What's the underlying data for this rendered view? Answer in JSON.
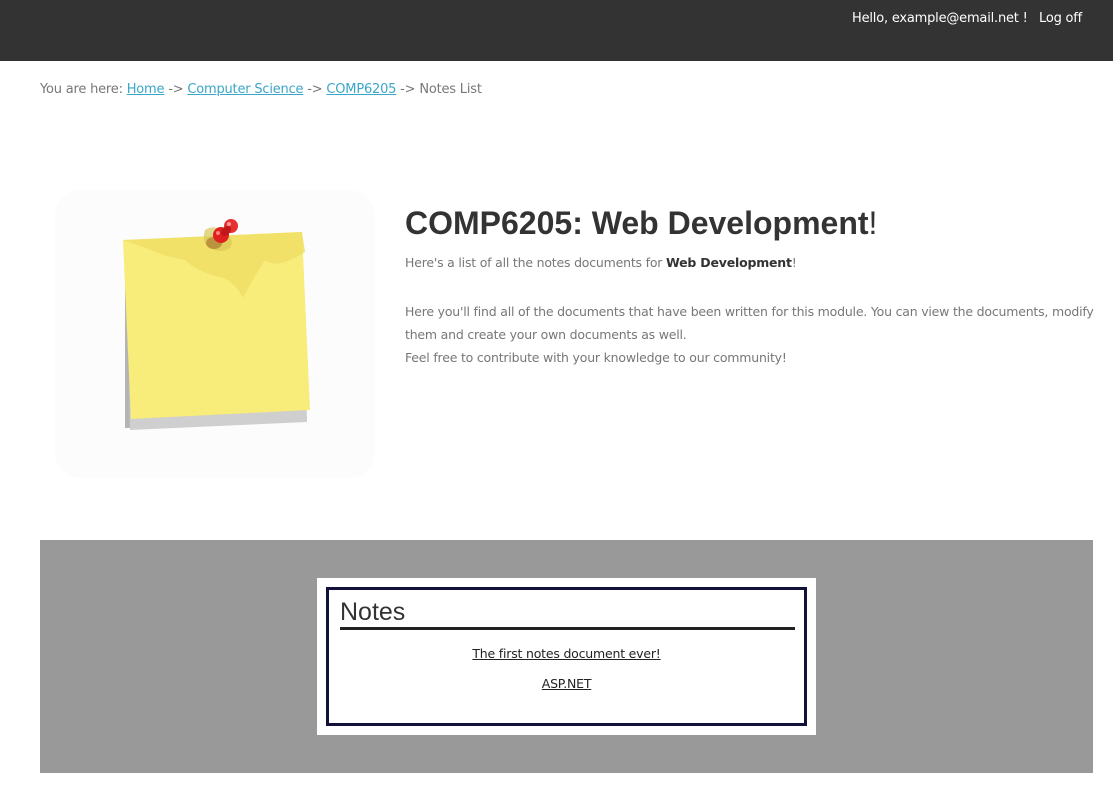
{
  "header": {
    "greeting": "Hello, example@email.net !",
    "logoff_label": "Log off"
  },
  "breadcrumb": {
    "prefix": "You are here:",
    "separator": " -> ",
    "links": [
      "Home",
      "Computer Science",
      "COMP6205"
    ],
    "current": "Notes List"
  },
  "hero": {
    "image": "sticky-note-pin",
    "title": "COMP6205: Web Development",
    "title_suffix": "!",
    "intro_prefix": "Here's a list of all the notes documents for ",
    "intro_bold": "Web Development",
    "intro_suffix": "!",
    "description_line1": "Here you'll find all of the documents that have been written for this module. You can view the documents, modify them and create your own documents as well.",
    "description_line2": "Feel free to contribute with your knowledge to our community!"
  },
  "notes": {
    "heading": "Notes",
    "documents": [
      "The first notes document ever!",
      "ASP.NET"
    ]
  },
  "colors": {
    "topbar": "#333333",
    "link": "#3aa6c8",
    "panel": "#999999",
    "card_border": "#11113a",
    "sticky_note": "#f8ec7a",
    "pin": "#e02020"
  }
}
